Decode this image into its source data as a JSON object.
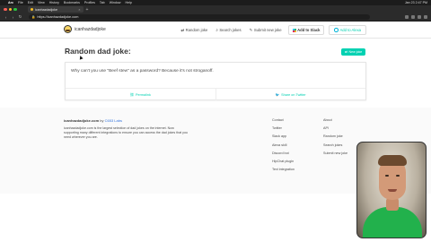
{
  "menubar": {
    "app": "Arc",
    "items": [
      "File",
      "Edit",
      "View",
      "History",
      "Bookmarks",
      "Profiles",
      "Tab",
      "Window",
      "Help"
    ],
    "clock": "Jan 23 2:47 PM"
  },
  "browser": {
    "tab_title": "icanhazdadjoke",
    "url": "https://icanhazdadjoke.com"
  },
  "site": {
    "brand": "icanhazdadjoke",
    "nav": {
      "random": "Random joke",
      "search": "Search jokes",
      "submit": "Submit new joke",
      "slack": "Add to Slack",
      "alexa": "Add to Alexa"
    },
    "title": "Random dad joke:",
    "new_joke_label": "New joke",
    "joke": "Why can't you use \"Beef stew\" as a password? Because it's not stroganoff.",
    "permalink_label": "Permalink",
    "share_label": "Share on Twitter"
  },
  "footer": {
    "brand": "icanhazdadjoke.com",
    "by": "by",
    "company": "C653 Labs",
    "description": "icanhazdadjoke.com is the largest selection of dad jokes on the internet. Now supporting many different integrations to ensure you can access the dad jokes that you need wherever you are.",
    "col1": [
      "Contact",
      "Twitter",
      "Slack app",
      "Alexa skill",
      "Discord bot",
      "HipChat plugin",
      "Text integration"
    ],
    "col2": [
      "About",
      "API",
      "Random joke",
      "Search jokes",
      "Submit new joke"
    ]
  },
  "colors": {
    "accent": "#00d1b2",
    "link": "#3273dc"
  }
}
